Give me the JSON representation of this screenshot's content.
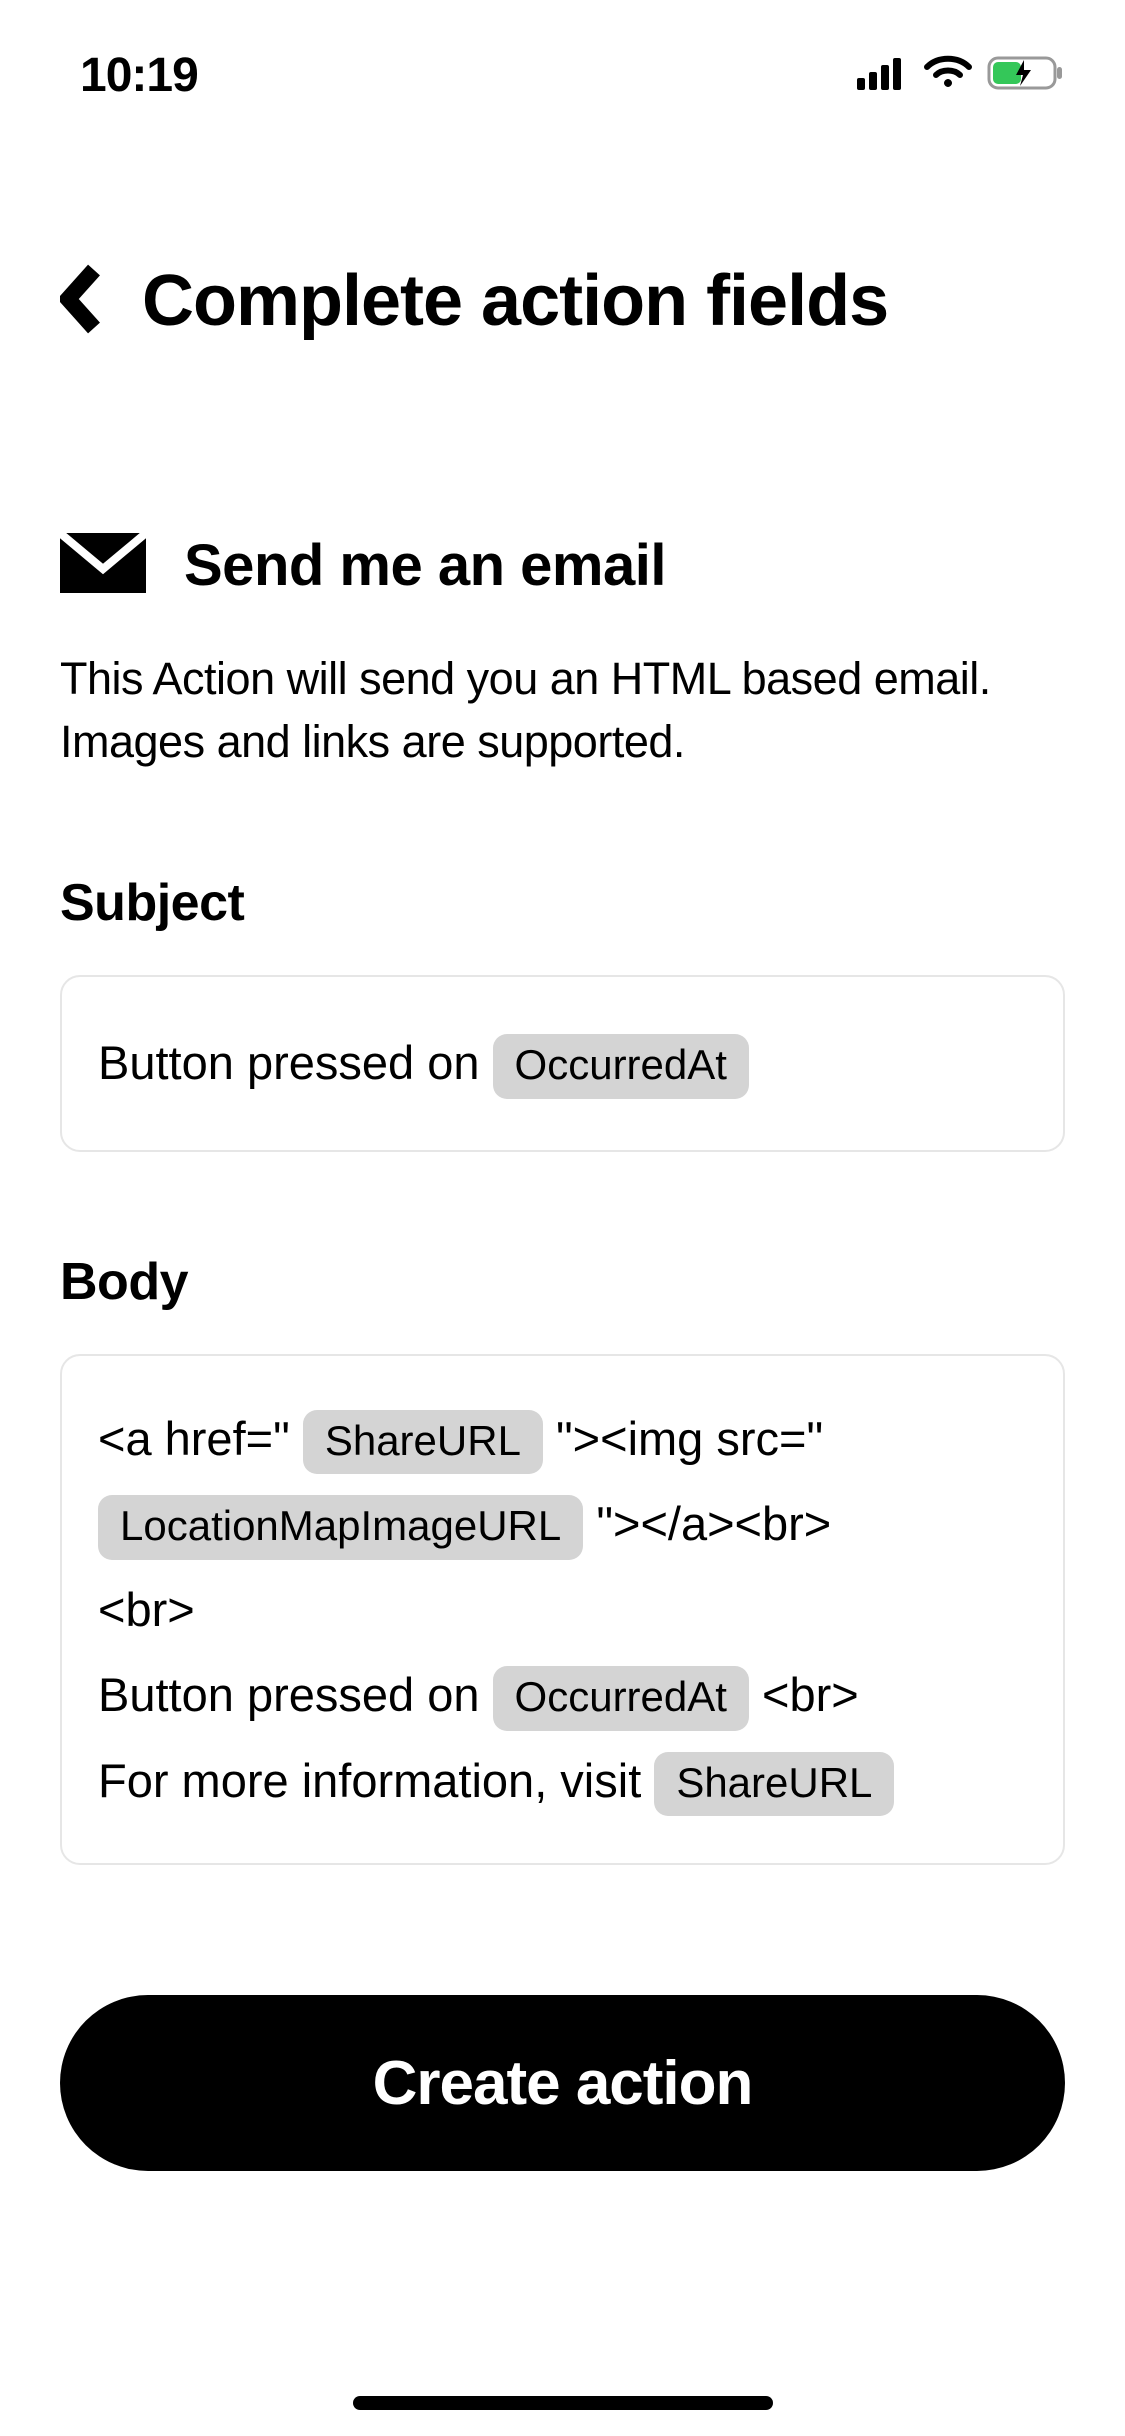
{
  "status": {
    "time": "10:19"
  },
  "header": {
    "title": "Complete action fields"
  },
  "action": {
    "title": "Send me an email",
    "description": "This Action will send you an HTML based email. Images and links are supported."
  },
  "fields": {
    "subject": {
      "label": "Subject",
      "parts": {
        "t1": "Button pressed on ",
        "pill1": "OccurredAt"
      }
    },
    "body": {
      "label": "Body",
      "parts": {
        "t1": "<a href=\"",
        "pill1": "ShareURL",
        "t2": "\"><img src=\"",
        "pill2": "LocationMapImageURL",
        "t3": "\"></a><br>",
        "t4": "<br>",
        "t5": "Button pressed on ",
        "pill3": "OccurredAt",
        "t6": " <br>",
        "t7": "For more information, visit ",
        "pill4": "ShareURL"
      }
    }
  },
  "buttons": {
    "create": "Create action"
  }
}
